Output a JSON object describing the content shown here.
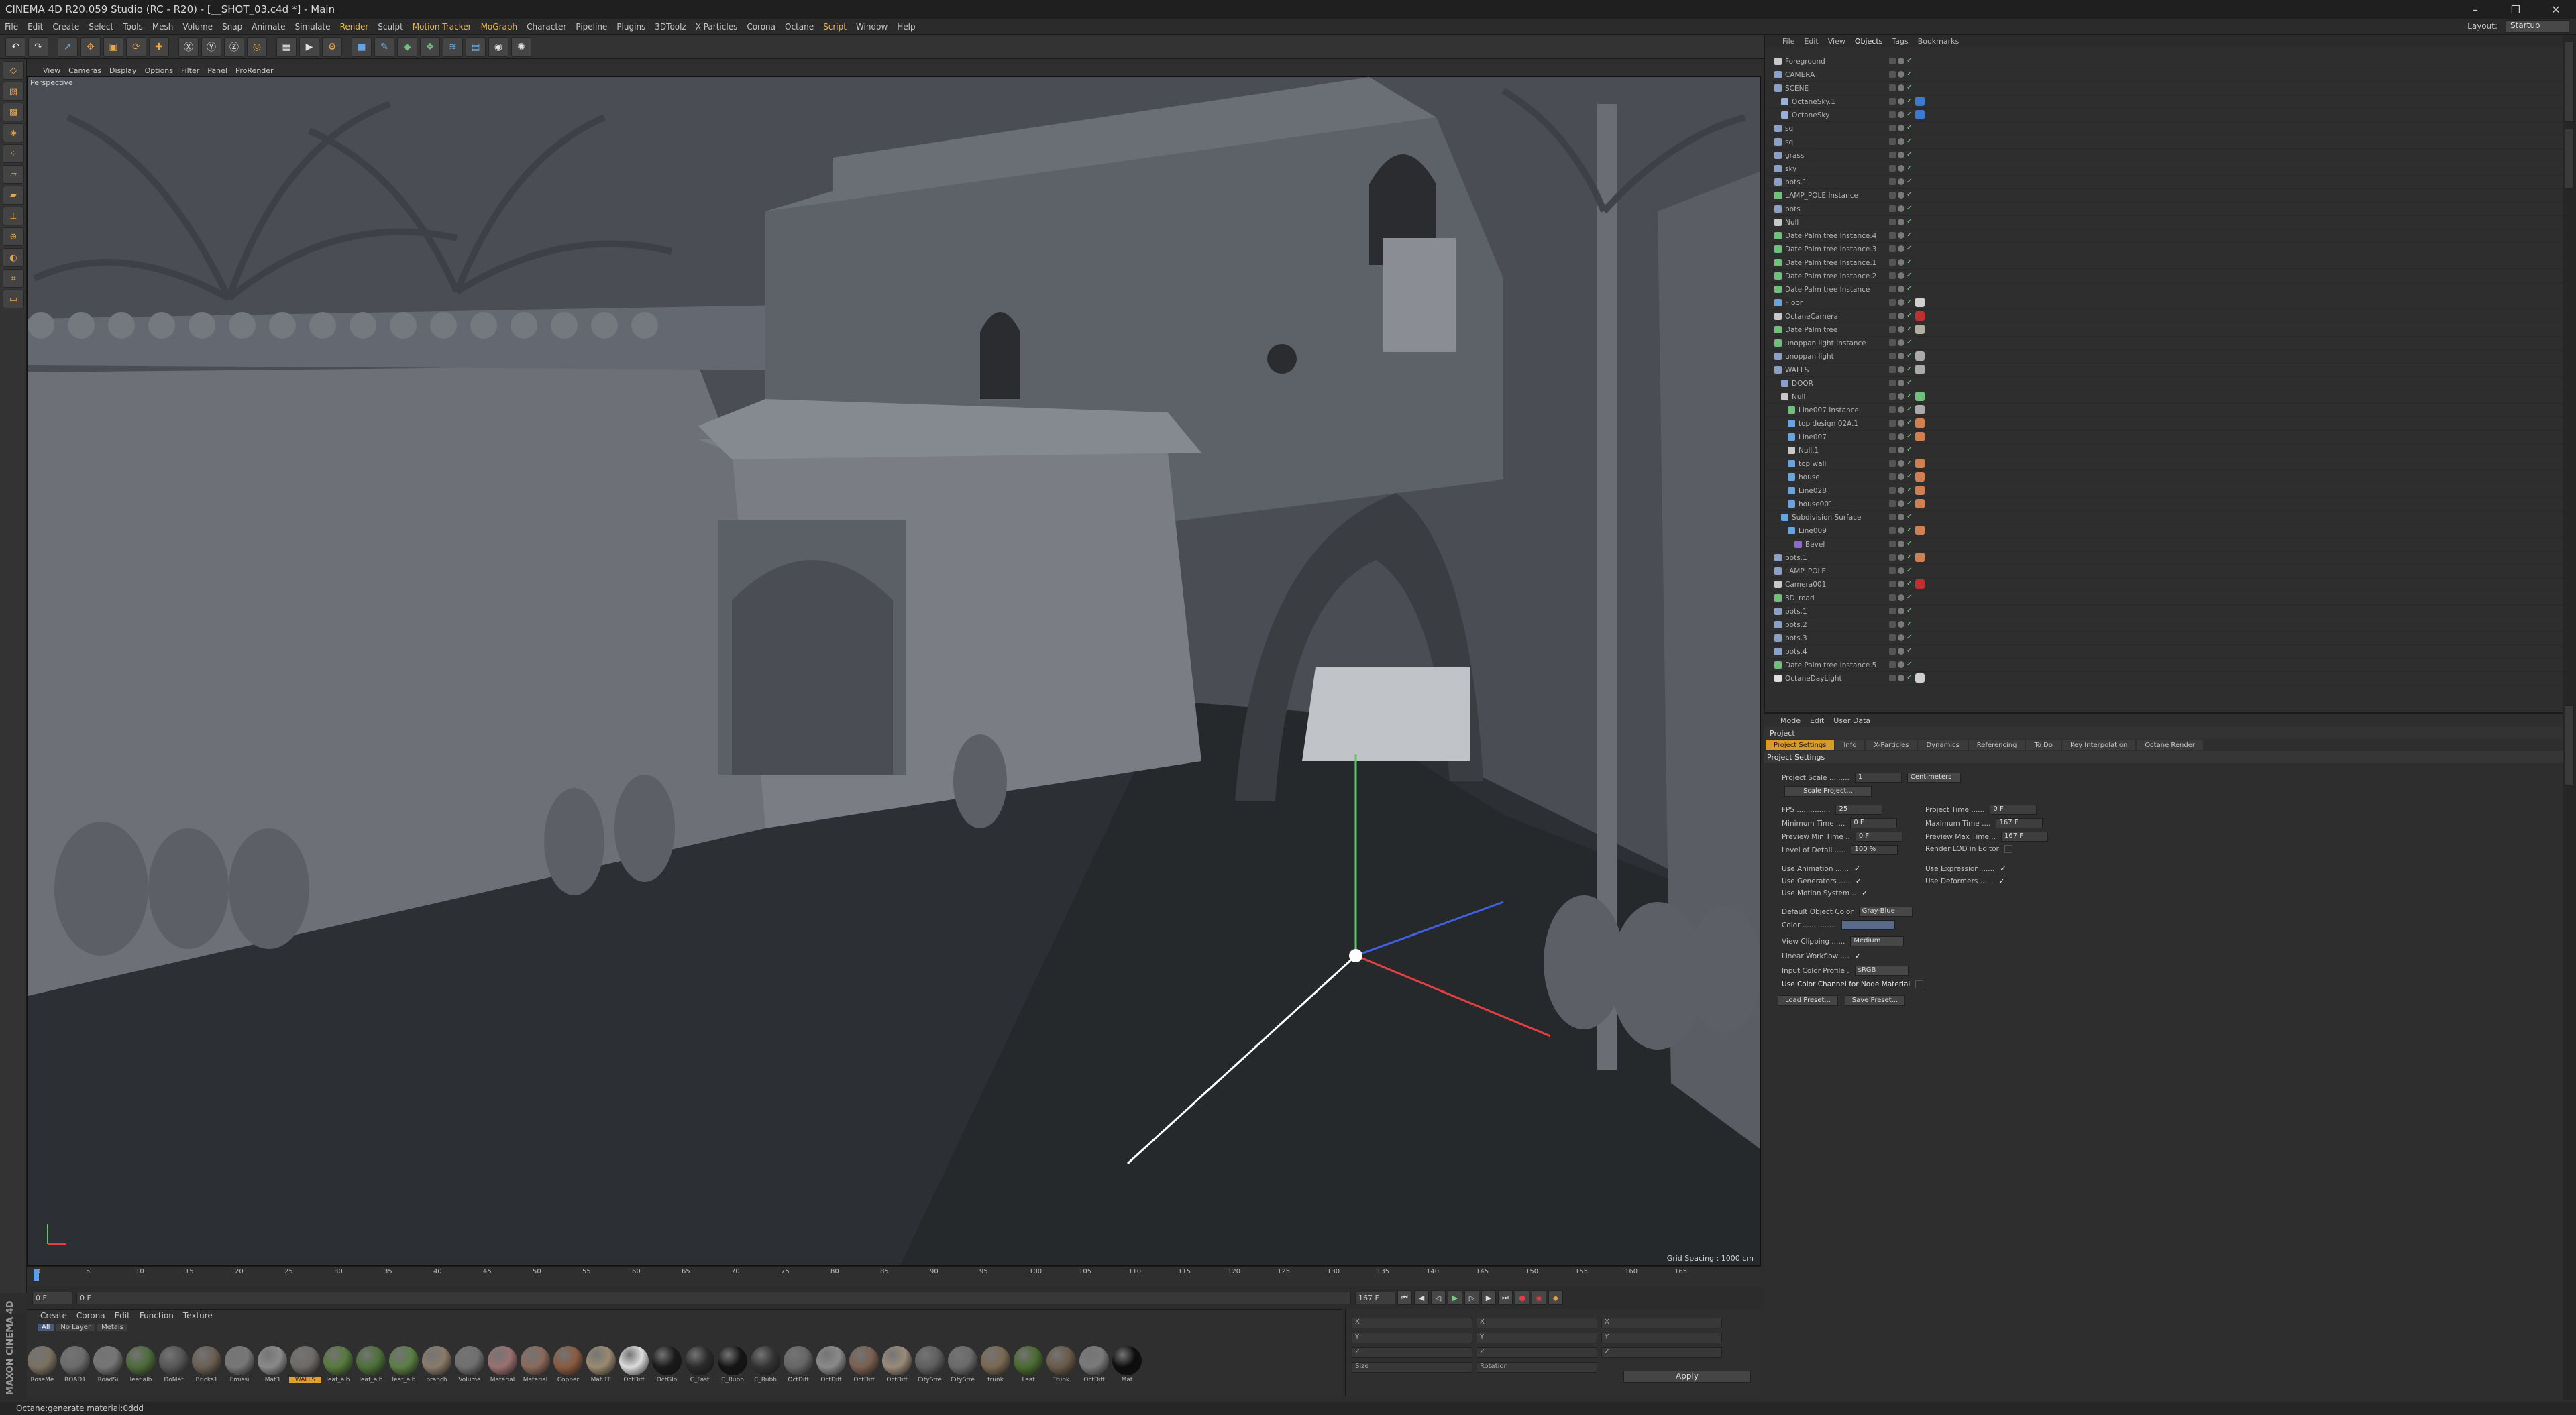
{
  "window": {
    "title": "CINEMA 4D R20.059 Studio (RC - R20) - [__SHOT_03.c4d *] - Main",
    "minimize": "–",
    "maximize": "❐",
    "close": "✕"
  },
  "menu": {
    "items": [
      "File",
      "Edit",
      "Create",
      "Select",
      "Tools",
      "Mesh",
      "Volume",
      "Snap",
      "Animate",
      "Simulate",
      "Render",
      "Sculpt",
      "Motion Tracker",
      "MoGraph",
      "Character",
      "Pipeline",
      "Plugins",
      "3DToolz",
      "X-Particles",
      "Corona",
      "Octane",
      "Script",
      "Window",
      "Help"
    ],
    "layout_label": "Layout:",
    "layout_value": "Startup"
  },
  "toolbar": {
    "buttons": [
      "undo",
      "redo",
      "select",
      "move",
      "scale",
      "rotate",
      "transform",
      "X",
      "Y",
      "Z",
      "world",
      "render-region",
      "render-view",
      "render-settings",
      "cube",
      "pen",
      "subdivision",
      "array",
      "spline",
      "camera",
      "light",
      "deformer"
    ]
  },
  "viewport": {
    "menu": [
      "View",
      "Cameras",
      "Display",
      "Options",
      "Filter",
      "Panel",
      "ProRender"
    ],
    "label": "Perspective",
    "grid_spacing": "Grid Spacing : 1000 cm"
  },
  "timeline": {
    "ticks": [
      "0",
      "5",
      "10",
      "15",
      "20",
      "25",
      "30",
      "35",
      "40",
      "45",
      "50",
      "55",
      "60",
      "65",
      "70",
      "75",
      "80",
      "85",
      "90",
      "95",
      "100",
      "105",
      "110",
      "115",
      "120",
      "125",
      "130",
      "135",
      "140",
      "145",
      "150",
      "155",
      "160",
      "165"
    ],
    "current_frame": "0 F",
    "start": "0 F",
    "min": "0 F",
    "max": "167 F",
    "end": "167 F"
  },
  "materials": {
    "tabs": [
      "Create",
      "Corona",
      "Edit",
      "Function",
      "Texture"
    ],
    "filters": [
      "All",
      "No Layer",
      "Metals"
    ],
    "items": [
      {
        "name": "RoseMe",
        "c": "#7a7060"
      },
      {
        "name": "ROAD1",
        "c": "#6b6b6b"
      },
      {
        "name": "RoadSi",
        "c": "#757575"
      },
      {
        "name": "leaf.alb",
        "c": "#4d6b3a"
      },
      {
        "name": "DoMat",
        "c": "#565656"
      },
      {
        "name": "Bricks1",
        "c": "#6a5e52"
      },
      {
        "name": "Emissi",
        "c": "#777"
      },
      {
        "name": "Mat3",
        "c": "#8a8a8a"
      },
      {
        "name": "WALLS",
        "c": "#6e6a66",
        "sel": true
      },
      {
        "name": "leaf_alb",
        "c": "#567a3c"
      },
      {
        "name": "leaf_alb",
        "c": "#4c7038"
      },
      {
        "name": "leaf_alb",
        "c": "#5a7f44"
      },
      {
        "name": "branch",
        "c": "#8a7a6a"
      },
      {
        "name": "Volume",
        "c": "#6f6f6f"
      },
      {
        "name": "Material",
        "c": "#9a7070"
      },
      {
        "name": "Material",
        "c": "#8a6a5a"
      },
      {
        "name": "Copper",
        "c": "#8a5a40"
      },
      {
        "name": "Mat.TE",
        "c": "#9a8a70"
      },
      {
        "name": "OctDiff",
        "c": "#dcdcdc"
      },
      {
        "name": "OctGlo",
        "c": "#1a1a1a"
      },
      {
        "name": "C_Fast",
        "c": "#2a2a2a"
      },
      {
        "name": "C_Rubb",
        "c": "#151515"
      },
      {
        "name": "C_Rubb",
        "c": "#333"
      },
      {
        "name": "OctDiff",
        "c": "#666"
      },
      {
        "name": "OctDiff",
        "c": "#8a8a8a"
      },
      {
        "name": "OctDiff",
        "c": "#7a6050"
      },
      {
        "name": "OctDiff",
        "c": "#9a8a78"
      },
      {
        "name": "CityStre",
        "c": "#5f5f5f"
      },
      {
        "name": "CityStre",
        "c": "#6a6a6a"
      },
      {
        "name": "trunk",
        "c": "#7a6850"
      },
      {
        "name": "Leaf",
        "c": "#4a6a30"
      },
      {
        "name": "Trunk",
        "c": "#6a5a48"
      },
      {
        "name": "OctDiff",
        "c": "#7a7a7a"
      },
      {
        "name": "Mat",
        "c": "#0d0d0d"
      }
    ]
  },
  "coords": {
    "apply": "Apply",
    "labels": [
      "X",
      "Y",
      "Z"
    ],
    "cols": [
      "Size",
      "Rotation"
    ]
  },
  "status": {
    "text": "Octane:generate material:0ddd"
  },
  "brand": {
    "text": "MAXON CINEMA 4D"
  },
  "objects": {
    "menu": [
      "File",
      "Edit",
      "View",
      "Objects",
      "Tags",
      "Bookmarks"
    ],
    "rows": [
      {
        "n": "Foreground",
        "d": 0,
        "ic": "#c8c8c8"
      },
      {
        "n": "CAMERA",
        "d": 0,
        "ic": "#8aa0c8"
      },
      {
        "n": "SCENE",
        "d": 0,
        "ic": "#8aa0c8"
      },
      {
        "n": "OctaneSky.1",
        "d": 1,
        "ic": "#9ab0d8",
        "tag": "#3a7ad0"
      },
      {
        "n": "OctaneSky",
        "d": 1,
        "ic": "#9ab0d8",
        "tag": "#3a7ad0"
      },
      {
        "n": "sq",
        "d": 0,
        "ic": "#8aa0c8"
      },
      {
        "n": "sq",
        "d": 0,
        "ic": "#8aa0c8"
      },
      {
        "n": "grass",
        "d": 0,
        "ic": "#8aa0c8"
      },
      {
        "n": "sky",
        "d": 0,
        "ic": "#8aa0c8"
      },
      {
        "n": "pots.1",
        "d": 0,
        "ic": "#8aa0c8"
      },
      {
        "n": "LAMP_POLE Instance",
        "d": 0,
        "ic": "#6fc07a"
      },
      {
        "n": "pots",
        "d": 0,
        "ic": "#8aa0c8"
      },
      {
        "n": "Null",
        "d": 0,
        "ic": "#c8c8c8"
      },
      {
        "n": "Date Palm tree Instance.4",
        "d": 0,
        "ic": "#6fc07a"
      },
      {
        "n": "Date Palm tree Instance.3",
        "d": 0,
        "ic": "#6fc07a"
      },
      {
        "n": "Date Palm tree Instance.1",
        "d": 0,
        "ic": "#6fc07a"
      },
      {
        "n": "Date Palm tree Instance.2",
        "d": 0,
        "ic": "#6fc07a"
      },
      {
        "n": "Date Palm tree Instance",
        "d": 0,
        "ic": "#6fc07a"
      },
      {
        "n": "Floor",
        "d": 0,
        "ic": "#67a4e0",
        "tag": "#d0d0d0"
      },
      {
        "n": "OctaneCamera",
        "d": 0,
        "ic": "#c8c8c8",
        "tag": "#c03030"
      },
      {
        "n": "Date Palm tree",
        "d": 0,
        "ic": "#6fc07a",
        "tag": "#b0b0a0"
      },
      {
        "n": "unoppan light Instance",
        "d": 0,
        "ic": "#6fc07a"
      },
      {
        "n": "unoppan light",
        "d": 0,
        "ic": "#8aa0c8",
        "tag": "#aaa"
      },
      {
        "n": "WALLS",
        "d": 0,
        "ic": "#8aa0c8",
        "tag": "#aaa"
      },
      {
        "n": "DOOR",
        "d": 1,
        "ic": "#8aa0c8"
      },
      {
        "n": "Null",
        "d": 1,
        "ic": "#c8c8c8",
        "tag": "#6fc07a"
      },
      {
        "n": "Line007 Instance",
        "d": 2,
        "ic": "#6fc07a",
        "tag": "#aaa"
      },
      {
        "n": "top design 02A.1",
        "d": 2,
        "ic": "#67a4e0",
        "tag": "#d08050"
      },
      {
        "n": "Line007",
        "d": 2,
        "ic": "#67a4e0",
        "tag": "#d08050"
      },
      {
        "n": "Null.1",
        "d": 2,
        "ic": "#c8c8c8"
      },
      {
        "n": "top wall",
        "d": 2,
        "ic": "#67a4e0",
        "tag": "#d08050"
      },
      {
        "n": "house",
        "d": 2,
        "ic": "#67a4e0",
        "tag": "#d08050"
      },
      {
        "n": "Line028",
        "d": 2,
        "ic": "#67a4e0",
        "tag": "#d08050"
      },
      {
        "n": "house001",
        "d": 2,
        "ic": "#67a4e0",
        "tag": "#d08050"
      },
      {
        "n": "Subdivision Surface",
        "d": 1,
        "ic": "#67a4e0"
      },
      {
        "n": "Line009",
        "d": 2,
        "ic": "#67a4e0",
        "tag": "#d08050"
      },
      {
        "n": "Bevel",
        "d": 3,
        "ic": "#8a6ad0"
      },
      {
        "n": "pots.1",
        "d": 0,
        "ic": "#8aa0c8",
        "tag": "#d08050"
      },
      {
        "n": "LAMP_POLE",
        "d": 0,
        "ic": "#8aa0c8"
      },
      {
        "n": "Camera001",
        "d": 0,
        "ic": "#c8c8c8",
        "tag": "#c03030"
      },
      {
        "n": "3D_road",
        "d": 0,
        "ic": "#6fc07a"
      },
      {
        "n": "pots.1",
        "d": 0,
        "ic": "#8aa0c8"
      },
      {
        "n": "pots.2",
        "d": 0,
        "ic": "#8aa0c8"
      },
      {
        "n": "pots.3",
        "d": 0,
        "ic": "#8aa0c8"
      },
      {
        "n": "pots.4",
        "d": 0,
        "ic": "#8aa0c8"
      },
      {
        "n": "Date Palm tree Instance.5",
        "d": 0,
        "ic": "#6fc07a"
      },
      {
        "n": "OctaneDayLight",
        "d": 0,
        "ic": "#e0e0e0",
        "tag": "#d0d0d0"
      }
    ]
  },
  "attributes": {
    "menu": [
      "Mode",
      "Edit",
      "User Data"
    ],
    "project": "Project",
    "tabs": [
      "Project Settings",
      "Info",
      "X-Particles",
      "Dynamics",
      "Referencing",
      "To Do",
      "Key Interpolation",
      "Octane Render"
    ],
    "section": "Project Settings",
    "project_scale": {
      "label": "Project Scale .........",
      "value": "1",
      "unit": "Centimeters"
    },
    "scale_btn": "Scale Project...",
    "left": [
      {
        "l": "FPS ...............",
        "v": "25"
      },
      {
        "l": "Minimum Time ....",
        "v": "0 F"
      },
      {
        "l": "Preview Min Time ..",
        "v": "0 F"
      },
      {
        "l": "Level of Detail .....",
        "v": "100 %"
      }
    ],
    "right": [
      {
        "l": "Project Time ......",
        "v": "0 F"
      },
      {
        "l": "Maximum Time ....",
        "v": "167 F"
      },
      {
        "l": "Preview Max Time ..",
        "v": "167 F"
      },
      {
        "l": "Render LOD in Editor",
        "c": ""
      }
    ],
    "checks_left": [
      {
        "l": "Use Animation ......",
        "c": "✓"
      },
      {
        "l": "Use Generators .....",
        "c": "✓"
      },
      {
        "l": "Use Motion System ..",
        "c": "✓"
      }
    ],
    "checks_right": [
      {
        "l": "Use Expression ......",
        "c": "✓"
      },
      {
        "l": "Use Deformers ......",
        "c": "✓"
      }
    ],
    "default_color": {
      "l": "Default Object Color",
      "v": "Gray-Blue"
    },
    "color": {
      "l": "Color ..............."
    },
    "view_clipping": {
      "l": "View Clipping ......",
      "v": "Medium"
    },
    "linear": {
      "l": "Linear Workflow ....",
      "c": "✓"
    },
    "input_profile": {
      "l": "Input Color Profile .",
      "v": "sRGB"
    },
    "node_mat": {
      "l": "Use Color Channel for Node Material",
      "c": ""
    },
    "load_btn": "Load Preset...",
    "save_btn": "Save Preset..."
  }
}
